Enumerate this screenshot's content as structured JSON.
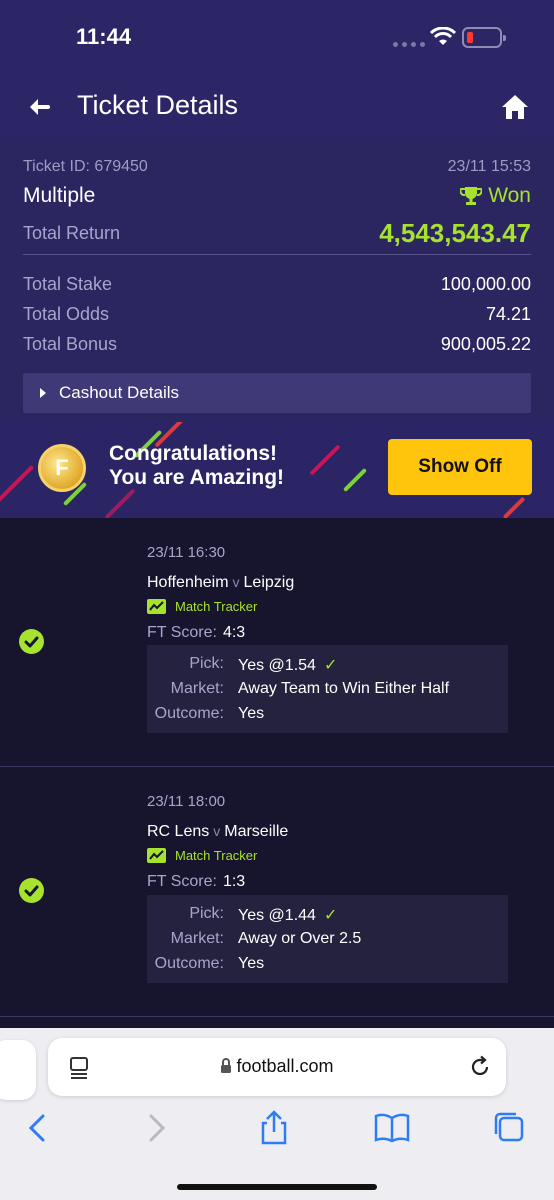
{
  "status_bar": {
    "time": "11:44"
  },
  "header": {
    "title": "Ticket Details"
  },
  "summary": {
    "ticket_id": "Ticket ID: 679450",
    "date": "23/11 15:53",
    "bet_type": "Multiple",
    "status": "Won",
    "total_return_label": "Total Return",
    "total_return_value": "4,543,543.47",
    "total_stake_label": "Total Stake",
    "total_stake_value": "100,000.00",
    "total_odds_label": "Total Odds",
    "total_odds_value": "74.21",
    "total_bonus_label": "Total Bonus",
    "total_bonus_value": "900,005.22",
    "cashout_label": "Cashout Details"
  },
  "banner": {
    "line1": "Congratulations!",
    "line2": "You are Amazing!",
    "button": "Show Off"
  },
  "selections": [
    {
      "date": "23/11 16:30",
      "home": "Hoffenheim",
      "vs": "v",
      "away": "Leipzig",
      "tracker": "Match Tracker",
      "ft_label": "FT Score:",
      "ft_value": "4:3",
      "pick_label": "Pick:",
      "pick_value": "Yes @1.54",
      "market_label": "Market:",
      "market_value": "Away Team to Win Either Half",
      "outcome_label": "Outcome:",
      "outcome_value": "Yes"
    },
    {
      "date": "23/11 18:00",
      "home": "RC Lens",
      "vs": "v",
      "away": "Marseille",
      "tracker": "Match Tracker",
      "ft_label": "FT Score:",
      "ft_value": "1:3",
      "pick_label": "Pick:",
      "pick_value": "Yes @1.44",
      "market_label": "Market:",
      "market_value": "Away or Over 2.5",
      "outcome_label": "Outcome:",
      "outcome_value": "Yes"
    }
  ],
  "browser": {
    "url": "football.com"
  },
  "colors": {
    "accent_green": "#a6e22e",
    "header_bg": "#2c2566",
    "button_yellow": "#ffc40c"
  }
}
